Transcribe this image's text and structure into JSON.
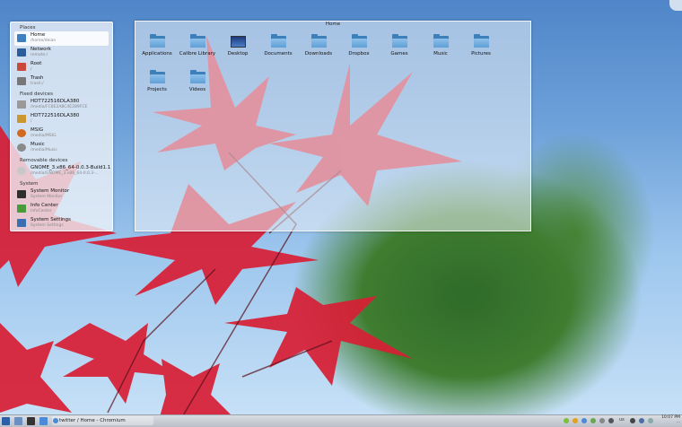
{
  "wallpaper": {
    "theme": "red-maple-leaves-over-green-tree"
  },
  "places_panel": {
    "section_places": "Places",
    "places": [
      {
        "name": "Home",
        "path": "/home/deian",
        "icon": "home-folder-icon",
        "color": "#3e7fbf"
      },
      {
        "name": "Network",
        "path": "remote:/",
        "icon": "network-icon",
        "color": "#2c5c9a"
      },
      {
        "name": "Root",
        "path": "/",
        "icon": "root-folder-icon",
        "color": "#c94a3a"
      },
      {
        "name": "Trash",
        "path": "trash:/",
        "icon": "trash-icon",
        "color": "#777777"
      }
    ],
    "section_fixed": "Fixed devices",
    "fixed": [
      {
        "name": "HDT722516DLA380",
        "path": "/media/FC8E2A8C4E289FCE",
        "icon": "hard-drive-icon",
        "color": "#9a9a9a"
      },
      {
        "name": "HDT722516DLA380",
        "path": "/",
        "icon": "hard-drive-icon",
        "color": "#c9962f"
      },
      {
        "name": "MSIG",
        "path": "/media/MSIG",
        "icon": "drive-icon",
        "color": "#d2691e"
      },
      {
        "name": "Music",
        "path": "/media/Music",
        "icon": "drive-icon",
        "color": "#8a8a8a"
      }
    ],
    "section_removable": "Removable devices",
    "removable": [
      {
        "name": "GNOME_3.x86_64-0.0.3-Build1.1",
        "path": "/media/GNOME_3.x86_64-0.0.3-...",
        "icon": "optical-disc-icon",
        "color": "#c8c8c8"
      }
    ],
    "section_system": "System",
    "system": [
      {
        "name": "System Monitor",
        "path": "System Monitor",
        "icon": "system-monitor-icon",
        "color": "#2f2f2f"
      },
      {
        "name": "Info Center",
        "path": "InfoCenter",
        "icon": "info-center-icon",
        "color": "#4a9a3a"
      },
      {
        "name": "System Settings",
        "path": "System Settings",
        "icon": "settings-icon",
        "color": "#3a6eb0"
      }
    ]
  },
  "home_window": {
    "title": "Home",
    "items": [
      {
        "label": "Applications",
        "type": "folder"
      },
      {
        "label": "Calibre Library",
        "type": "folder"
      },
      {
        "label": "Desktop",
        "type": "desktop"
      },
      {
        "label": "Documents",
        "type": "folder"
      },
      {
        "label": "Downloads",
        "type": "folder"
      },
      {
        "label": "Dropbox",
        "type": "folder"
      },
      {
        "label": "Games",
        "type": "folder"
      },
      {
        "label": "Music",
        "type": "folder"
      },
      {
        "label": "Pictures",
        "type": "folder"
      },
      {
        "label": "Projects",
        "type": "folder"
      },
      {
        "label": "Videos",
        "type": "folder"
      }
    ]
  },
  "taskbar": {
    "task_label": "twitter / Home - Chromium",
    "keyboard_layout": "us",
    "clock_time": "10:07 PM",
    "clock_date": "..."
  }
}
